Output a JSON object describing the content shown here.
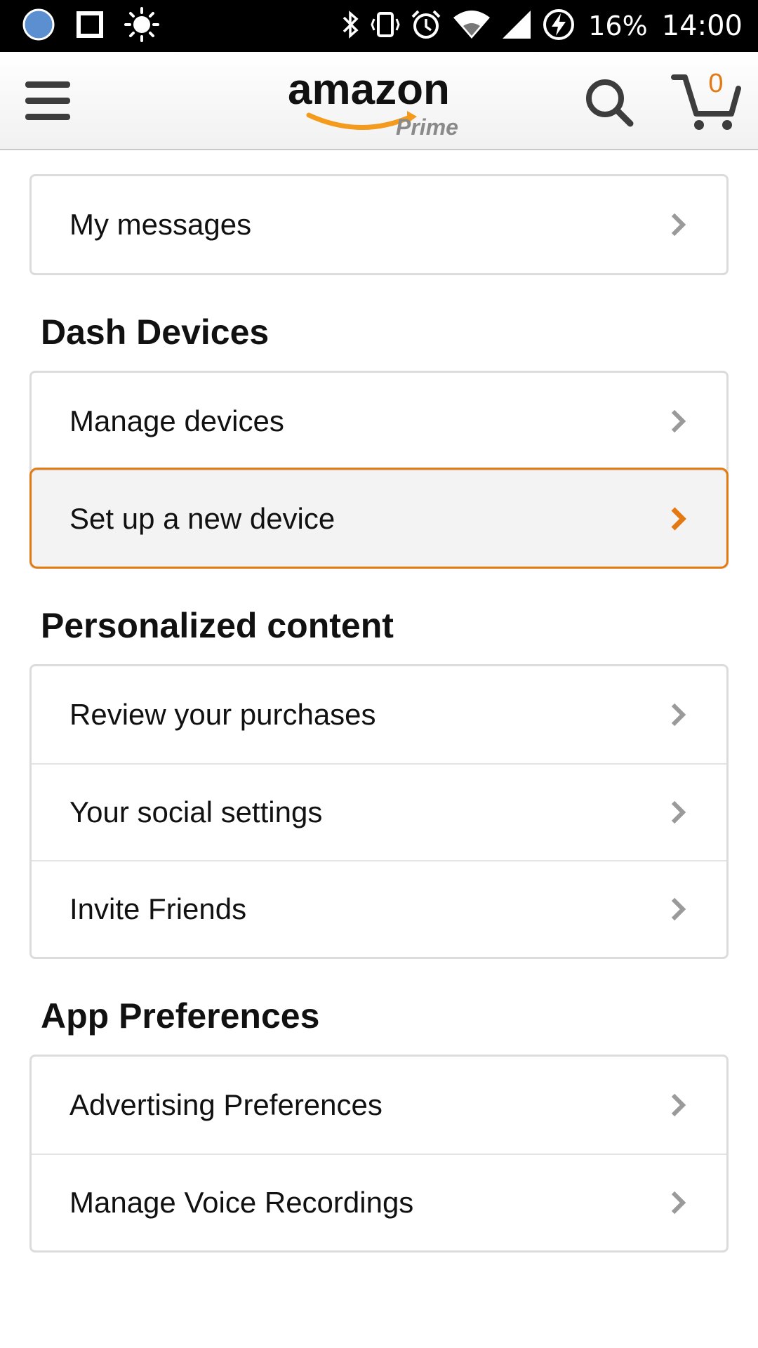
{
  "status_bar": {
    "battery_percent": "16%",
    "time": "14:00"
  },
  "header": {
    "logo_text": "amazon",
    "logo_subtext": "Prime",
    "cart_count": "0"
  },
  "sections": {
    "account_top": {
      "items": [
        {
          "label": "My messages"
        }
      ]
    },
    "dash_devices": {
      "title": "Dash Devices",
      "items": [
        {
          "label": "Manage devices"
        },
        {
          "label": "Set up a new device"
        }
      ]
    },
    "personalized_content": {
      "title": "Personalized content",
      "items": [
        {
          "label": "Review your purchases"
        },
        {
          "label": "Your social settings"
        },
        {
          "label": "Invite Friends"
        }
      ]
    },
    "app_preferences": {
      "title": "App Preferences",
      "items": [
        {
          "label": "Advertising Preferences"
        },
        {
          "label": "Manage Voice Recordings"
        }
      ]
    }
  },
  "colors": {
    "accent": "#e47911",
    "chevron": "#9a9a9a",
    "active_row_bg": "#f3f3f3"
  }
}
